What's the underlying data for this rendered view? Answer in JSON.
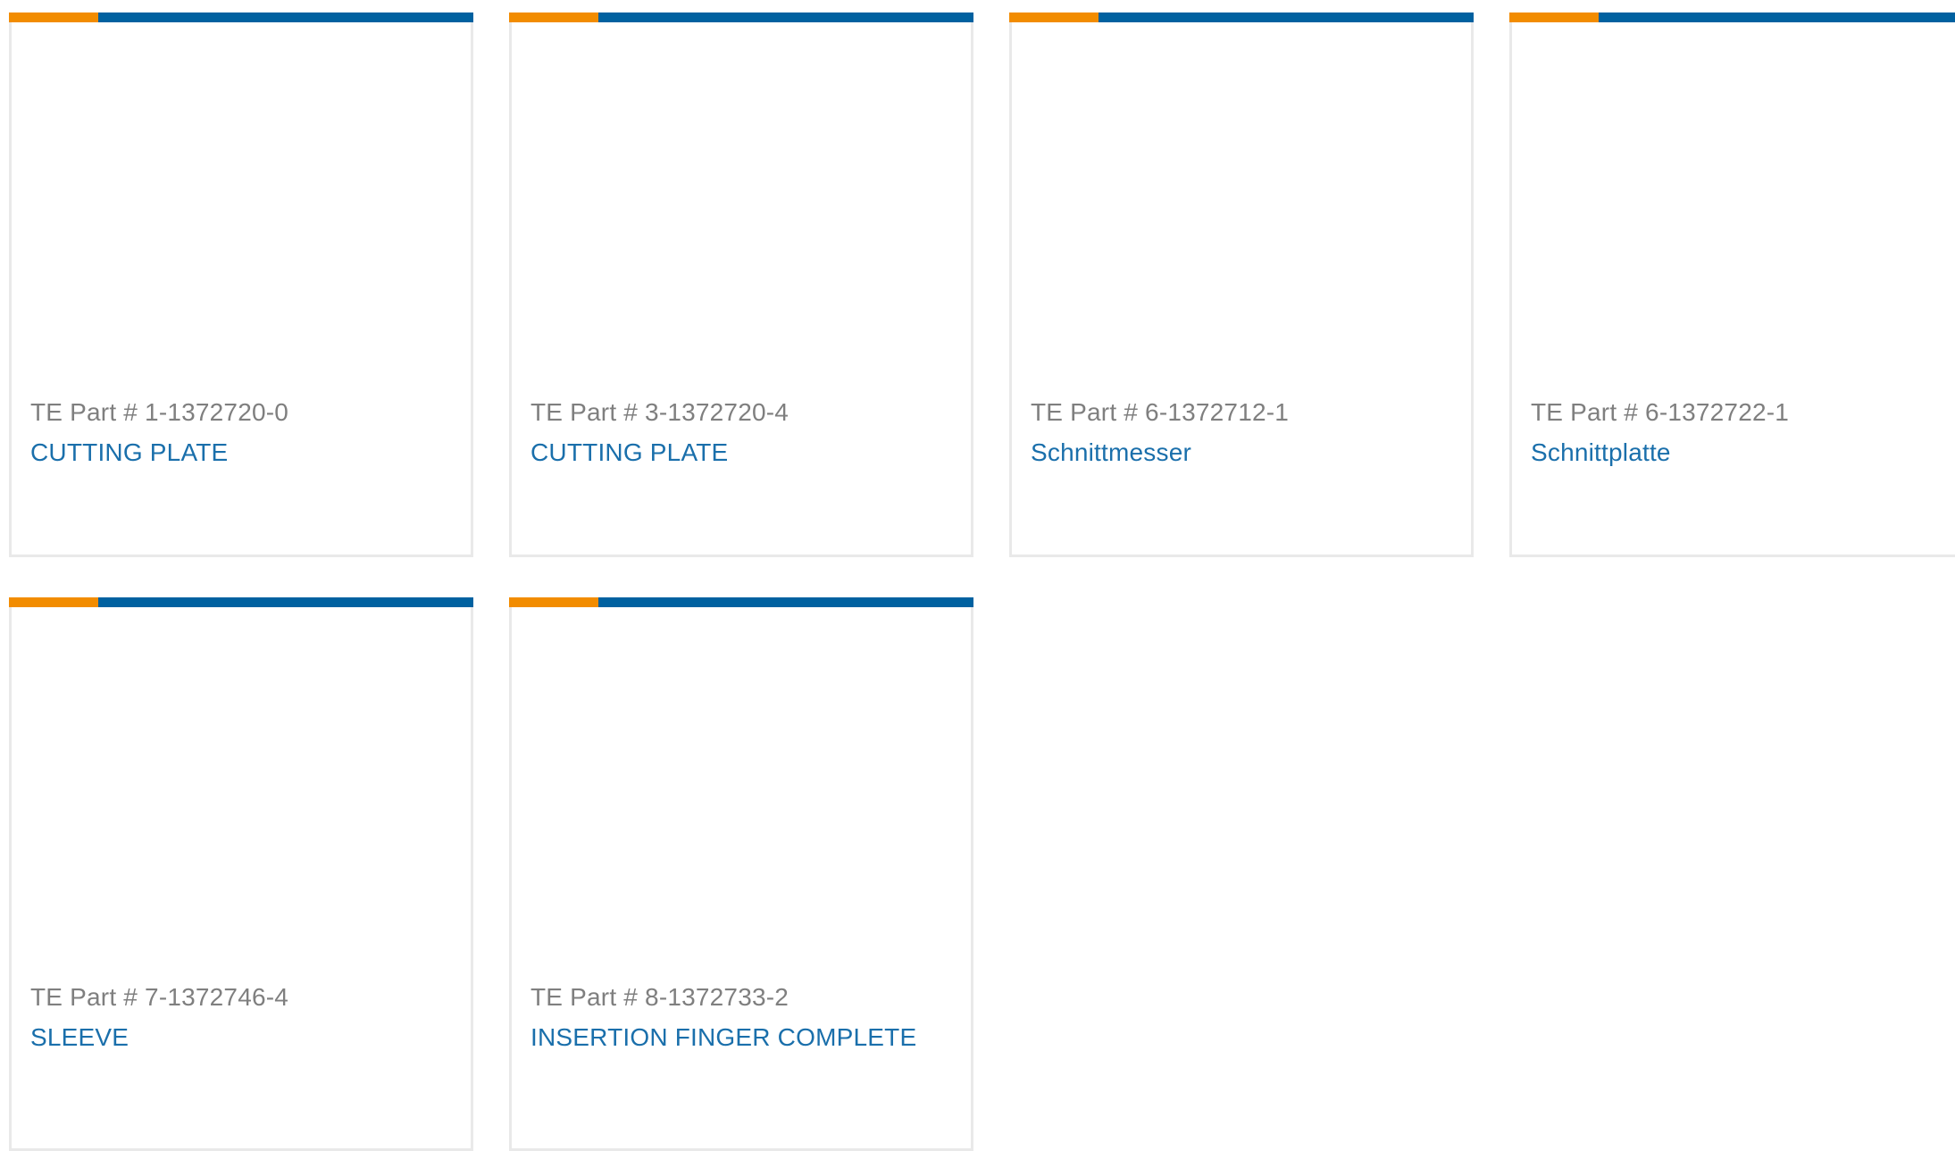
{
  "colors": {
    "accent_orange": "#f28c00",
    "accent_blue": "#0061a0",
    "part_number_text": "#7f7f7f",
    "product_name_link": "#1a6fab",
    "card_border": "#e9e9e9"
  },
  "products": [
    {
      "part_number": "TE Part # 1-1372720-0",
      "name": "CUTTING PLATE"
    },
    {
      "part_number": "TE Part # 3-1372720-4",
      "name": "CUTTING PLATE"
    },
    {
      "part_number": "TE Part # 6-1372712-1",
      "name": "Schnittmesser"
    },
    {
      "part_number": "TE Part # 6-1372722-1",
      "name": "Schnittplatte"
    },
    {
      "part_number": "TE Part # 7-1372746-4",
      "name": "SLEEVE"
    },
    {
      "part_number": "TE Part # 8-1372733-2",
      "name": "INSERTION FINGER COMPLETE"
    }
  ]
}
